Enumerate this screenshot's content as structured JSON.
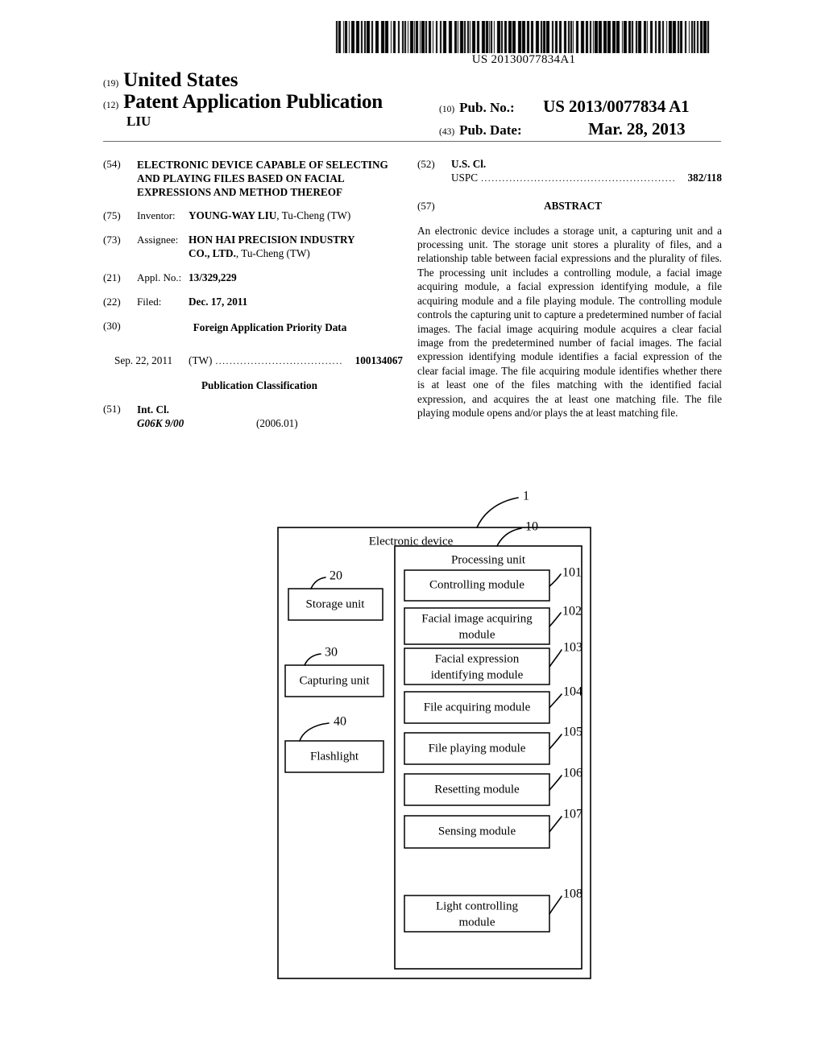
{
  "barcode": {
    "publication_number_text": "US 20130077834A1"
  },
  "header": {
    "inid_19": "(19)",
    "country": "United States",
    "inid_12": "(12)",
    "doc_type": "Patent Application Publication",
    "inventor_surname": "LIU",
    "inid_10": "(10)",
    "pub_no_label": "Pub. No.:",
    "pub_no_value": "US 2013/0077834 A1",
    "inid_43": "(43)",
    "pub_date_label": "Pub. Date:",
    "pub_date_value": "Mar. 28, 2013"
  },
  "left_column": {
    "title": {
      "code": "(54)",
      "text": "ELECTRONIC DEVICE CAPABLE OF SELECTING AND PLAYING FILES BASED ON FACIAL EXPRESSIONS AND METHOD THEREOF"
    },
    "inventor": {
      "code": "(75)",
      "label": "Inventor:",
      "name": "YOUNG-WAY LIU",
      "residence": ", Tu-Cheng (TW)"
    },
    "assignee": {
      "code": "(73)",
      "label": "Assignee:",
      "name_line1": "HON HAI PRECISION INDUSTRY",
      "name_line2": "CO., LTD.",
      "residence": ", Tu-Cheng (TW)"
    },
    "appl_no": {
      "code": "(21)",
      "label": "Appl. No.:",
      "value": "13/329,229"
    },
    "filed": {
      "code": "(22)",
      "label": "Filed:",
      "value": "Dec. 17, 2011"
    },
    "foreign_priority": {
      "code": "(30)",
      "heading": "Foreign Application Priority Data",
      "date": "Sep. 22, 2011",
      "country": "(TW)",
      "dots": "....................................",
      "number": "100134067"
    },
    "publication_classification": {
      "heading": "Publication Classification",
      "code": "(51)",
      "label": "Int. Cl.",
      "class_code": "G06K 9/00",
      "class_version": "(2006.01)"
    }
  },
  "right_column": {
    "us_cl": {
      "code": "(52)",
      "label": "U.S. Cl.",
      "sub_label": "USPC",
      "dots": ".......................................................",
      "value": "382/118"
    },
    "abstract": {
      "code": "(57)",
      "heading": "ABSTRACT",
      "text": "An electronic device includes a storage unit, a capturing unit and a processing unit. The storage unit stores a plurality of files, and a relationship table between facial expressions and the plurality of files. The processing unit includes a controlling module, a facial image acquiring module, a facial expression identifying module, a file acquiring module and a file playing module. The controlling module controls the capturing unit to capture a predetermined number of facial images. The facial image acquiring module acquires a clear facial image from the predetermined number of facial images. The facial expression identifying module identifies a facial expression of the clear facial image. The file acquiring module identifies whether there is at least one of the files matching with the identified facial expression, and acquires the at least one matching file. The file playing module opens and/or plays the at least matching file."
    }
  },
  "figure": {
    "outer_ref": "1",
    "outer_label": "Electronic device",
    "processing_unit_ref": "10",
    "processing_unit_label": "Processing unit",
    "left_blocks": [
      {
        "ref": "20",
        "label": "Storage unit"
      },
      {
        "ref": "30",
        "label": "Capturing unit"
      },
      {
        "ref": "40",
        "label": "Flashlight"
      }
    ],
    "modules": [
      {
        "ref": "101",
        "label": "Controlling module"
      },
      {
        "ref": "102",
        "label": "Facial image acquiring module"
      },
      {
        "ref": "103",
        "label": "Facial expression identifying module"
      },
      {
        "ref": "104",
        "label": "File acquiring module"
      },
      {
        "ref": "105",
        "label": "File playing module"
      },
      {
        "ref": "106",
        "label": "Resetting module"
      },
      {
        "ref": "107",
        "label": "Sensing module"
      },
      {
        "ref": "108",
        "label": "Light controlling module"
      }
    ]
  }
}
